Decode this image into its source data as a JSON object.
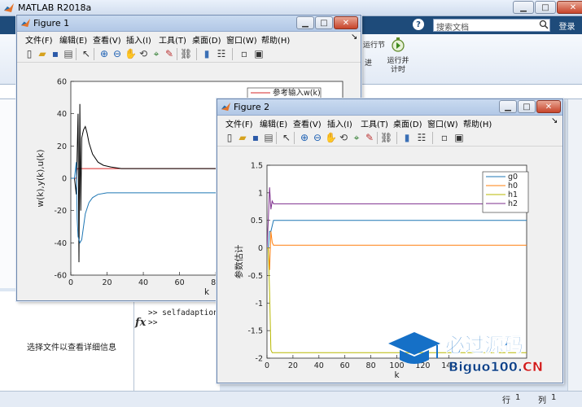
{
  "matlab": {
    "window_title": "MATLAB R2018a",
    "search_placeholder": "搜索文档",
    "login_label": "登录",
    "run_section_label": "运行节",
    "advance_label": "进",
    "run_time_label": "运行并\n计时",
    "details_text": "选择文件以查看详细信息",
    "cmd_history": ">> selfadaption",
    "cmd_prompt": ">>",
    "fx_label": "fx",
    "status_row_label": "行",
    "status_row_value": "1",
    "status_col_label": "列",
    "status_col_value": "1"
  },
  "figure1": {
    "title": "Figure 1",
    "menu": [
      "文件(F)",
      "编辑(E)",
      "查看(V)",
      "插入(I)",
      "工具(T)",
      "桌面(D)",
      "窗口(W)",
      "帮助(H)"
    ],
    "toolbar_icons": [
      "new-figure-icon",
      "open-file-icon",
      "save-icon",
      "print-icon",
      "edit-plot-icon",
      "zoom-in-icon",
      "zoom-out-icon",
      "pan-icon",
      "rotate-3d-icon",
      "data-cursor-icon",
      "brush-icon",
      "link-plot-icon",
      "colorbar-icon",
      "legend-icon",
      "hide-plot-tools-icon",
      "show-plot-tools-icon"
    ]
  },
  "figure2": {
    "title": "Figure 2",
    "menu": [
      "文件(F)",
      "编辑(E)",
      "查看(V)",
      "插入(I)",
      "工具(T)",
      "桌面(D)",
      "窗口(W)",
      "帮助(H)"
    ],
    "toolbar_icons": [
      "new-figure-icon",
      "open-file-icon",
      "save-icon",
      "print-icon",
      "edit-plot-icon",
      "zoom-in-icon",
      "zoom-out-icon",
      "pan-icon",
      "rotate-3d-icon",
      "data-cursor-icon",
      "brush-icon",
      "link-plot-icon",
      "colorbar-icon",
      "legend-icon",
      "hide-plot-tools-icon",
      "show-plot-tools-icon"
    ]
  },
  "watermark": {
    "brand_cn": "必过源码",
    "brand_url": "Biguo100.CN"
  },
  "chart_data": [
    {
      "type": "line",
      "xlabel": "k",
      "ylabel": "w(k),y(k),u(k)",
      "xlim": [
        0,
        150
      ],
      "ylim": [
        -60,
        60
      ],
      "xticks": [
        0,
        20,
        40,
        60,
        80
      ],
      "yticks": [
        60,
        40,
        20,
        0,
        -20,
        -40,
        -60
      ],
      "legend_position": "top-right",
      "series": [
        {
          "name": "参考输入w(k)",
          "color": "#d62728",
          "x": [
            0,
            3,
            3.5,
            5,
            100
          ],
          "y": [
            0,
            0,
            6,
            6,
            6
          ]
        },
        {
          "name": "",
          "color": "#000000",
          "x": [
            0,
            2,
            3,
            4,
            4.5,
            5,
            5.5,
            6,
            7,
            8,
            9,
            10,
            12,
            15,
            18,
            22,
            28,
            35,
            50,
            75,
            100
          ],
          "y": [
            0,
            0,
            -10,
            40,
            -52,
            46,
            -20,
            25,
            30,
            32,
            28,
            22,
            15,
            10,
            8,
            7,
            6,
            6,
            6,
            6,
            6
          ]
        },
        {
          "name": "",
          "color": "#1f77b4",
          "x": [
            0,
            2,
            3,
            3.5,
            4,
            5,
            6,
            7,
            8,
            10,
            12,
            15,
            20,
            30,
            50,
            75,
            100
          ],
          "y": [
            0,
            0,
            10,
            -25,
            -36,
            -40,
            -38,
            -30,
            -22,
            -15,
            -12,
            -10,
            -9,
            -9,
            -9,
            -9,
            -9
          ]
        }
      ]
    },
    {
      "type": "line",
      "xlabel": "k",
      "ylabel": "参数估计",
      "xlim": [
        0,
        200
      ],
      "ylim": [
        -2,
        1.5
      ],
      "xticks": [
        0,
        20,
        40,
        60,
        80,
        100,
        120,
        140
      ],
      "yticks": [
        1.5,
        1,
        0.5,
        0,
        -0.5,
        -1,
        -1.5,
        -2
      ],
      "legend_position": "top-right",
      "series": [
        {
          "name": "g0",
          "color": "#1f77b4",
          "x": [
            0,
            1,
            2,
            3,
            4,
            5,
            6,
            200
          ],
          "y": [
            0.0,
            0.0,
            0.3,
            0.3,
            0.4,
            0.5,
            0.5,
            0.5
          ]
        },
        {
          "name": "h0",
          "color": "#ff7f0e",
          "x": [
            0,
            1,
            2,
            3,
            4,
            5,
            6,
            200
          ],
          "y": [
            0,
            0,
            -0.4,
            0.3,
            0.1,
            0.05,
            0.05,
            0.05
          ]
        },
        {
          "name": "h1",
          "color": "#b8b800",
          "x": [
            0,
            1,
            2,
            3,
            4,
            5,
            6,
            200
          ],
          "y": [
            0,
            0,
            -0.8,
            -1.85,
            -1.9,
            -1.9,
            -1.9,
            -1.9
          ]
        },
        {
          "name": "h2",
          "color": "#7e2f8e",
          "x": [
            0,
            1,
            2,
            3,
            4,
            5,
            6,
            200
          ],
          "y": [
            0.0,
            0.5,
            1.1,
            0.7,
            0.85,
            0.8,
            0.8,
            0.8
          ]
        }
      ]
    }
  ]
}
